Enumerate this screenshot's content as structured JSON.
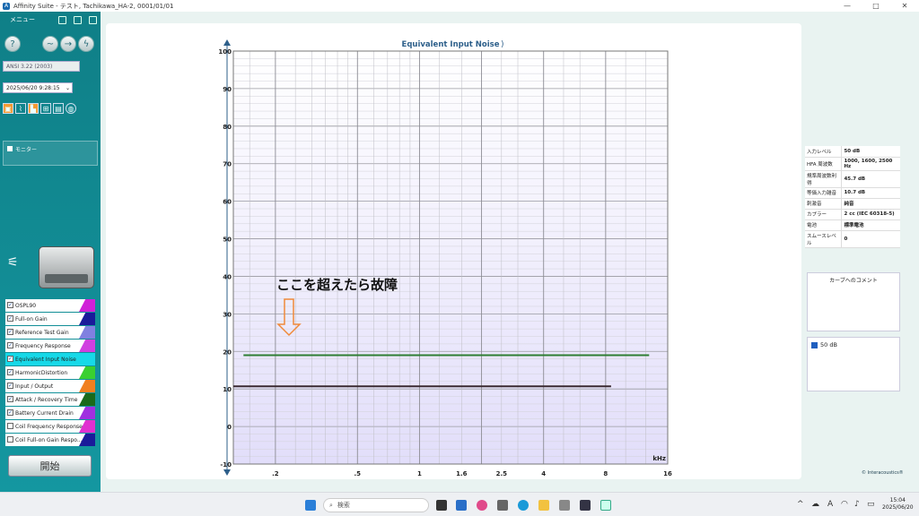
{
  "window": {
    "title": "Affinity Suite - テスト, Tachikawa_HA-2, 0001/01/01"
  },
  "left": {
    "menu_label": "メニュー",
    "standard": "ANSI 3.22 (2003)",
    "datetime": "2025/06/20 9:28:15",
    "monitor_label": "モニター",
    "start_label": "開始",
    "tests": [
      {
        "label": "OSPL90",
        "checked": true,
        "color": "#d020d8"
      },
      {
        "label": "Full-on Gain",
        "checked": true,
        "color": "#1a1a9a"
      },
      {
        "label": "Reference Test Gain",
        "checked": true,
        "color": "#8080e0"
      },
      {
        "label": "Frequency Response",
        "checked": true,
        "color": "#d040e0"
      },
      {
        "label": "Equivalent Input Noise",
        "checked": true,
        "color": "#17d9e8",
        "active": true
      },
      {
        "label": "HarmonicDistortion",
        "checked": true,
        "color": "#3ad030"
      },
      {
        "label": "Input / Output",
        "checked": true,
        "color": "#f08020"
      },
      {
        "label": "Attack / Recovery Time",
        "checked": true,
        "color": "#1a6a1a"
      },
      {
        "label": "Battery Current Drain",
        "checked": true,
        "color": "#a030e0"
      },
      {
        "label": "Coil Frequency Response",
        "checked": false,
        "color": "#e030d0"
      },
      {
        "label": "Coil Full-on Gain Respo...",
        "checked": false,
        "color": "#1a1a9a"
      }
    ]
  },
  "chart_data": {
    "type": "line",
    "title": "Equivalent Input Noise",
    "xlabel": "kHz",
    "ylabel": "",
    "x_scale": "log",
    "xlim": [
      0.125,
      16
    ],
    "ylim": [
      -10,
      100
    ],
    "x_ticks": [
      ".2",
      ".5",
      "1",
      "1.6",
      "2.5",
      "4",
      "8",
      "16"
    ],
    "y_ticks": [
      "100",
      "90",
      "80",
      "70",
      "60",
      "50",
      "40",
      "30",
      "20",
      "10",
      "0",
      "-10"
    ],
    "series": [
      {
        "color": "#2e7d32",
        "x": [
          0.14,
          13
        ],
        "values": [
          19,
          19
        ]
      },
      {
        "color": "#3a2a30",
        "x": [
          0.125,
          8.5
        ],
        "values": [
          10.7,
          10.7
        ]
      }
    ],
    "annotation": "ここを超えたら故障",
    "annotation_arrow_color": "#f08a3a",
    "grid": true
  },
  "right": {
    "info": [
      {
        "label": "入力レベル",
        "value": "50 dB"
      },
      {
        "label": "HFA 周波数",
        "value": "1000, 1600, 2500 Hz"
      },
      {
        "label": "規準周波数利得",
        "value": "45.7 dB"
      },
      {
        "label": "等価入力雑音",
        "value": "10.7 dB"
      },
      {
        "label": "刺激音",
        "value": "純音"
      },
      {
        "label": "カプラー",
        "value": "2 cc (IEC 60318-5)"
      },
      {
        "label": "電池",
        "value": "標準電池"
      },
      {
        "label": "スムースレベル",
        "value": "0"
      }
    ],
    "comment_title": "カーブへのコメント",
    "legend_item": "50 dB",
    "brand": "© Interacoustics®"
  },
  "taskbar": {
    "search_placeholder": "検索",
    "time": "15:04",
    "date": "2025/06/20"
  }
}
